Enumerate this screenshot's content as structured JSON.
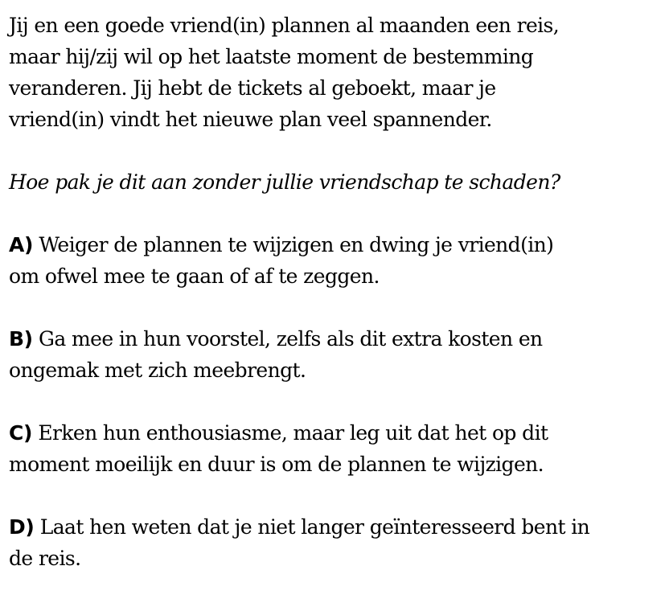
{
  "scenario": {
    "lines": [
      "Jij en een goede vriend(in) plannen al maanden een reis,",
      "maar hij/zij wil op het laatste moment de bestemming",
      "veranderen. Jij hebt de tickets al geboekt, maar je",
      "vriend(in) vindt het nieuwe plan veel spannender."
    ]
  },
  "question": "Hoe pak je dit aan zonder jullie vriendschap te schaden?",
  "options": [
    {
      "letter": "A)",
      "lines": [
        " Weiger de plannen te wijzigen en dwing je vriend(in)",
        "om ofwel mee te gaan of af te zeggen."
      ]
    },
    {
      "letter": "B)",
      "lines": [
        " Ga mee in hun voorstel, zelfs als dit extra kosten en",
        "ongemak met zich meebrengt."
      ]
    },
    {
      "letter": "C)",
      "lines": [
        " Erken hun enthousiasme, maar leg uit dat het op dit",
        "moment moeilijk en duur is om de plannen te wijzigen."
      ]
    },
    {
      "letter": "D)",
      "lines": [
        " Laat hen weten dat je niet langer geïnteresseerd bent in",
        "de reis."
      ]
    }
  ]
}
